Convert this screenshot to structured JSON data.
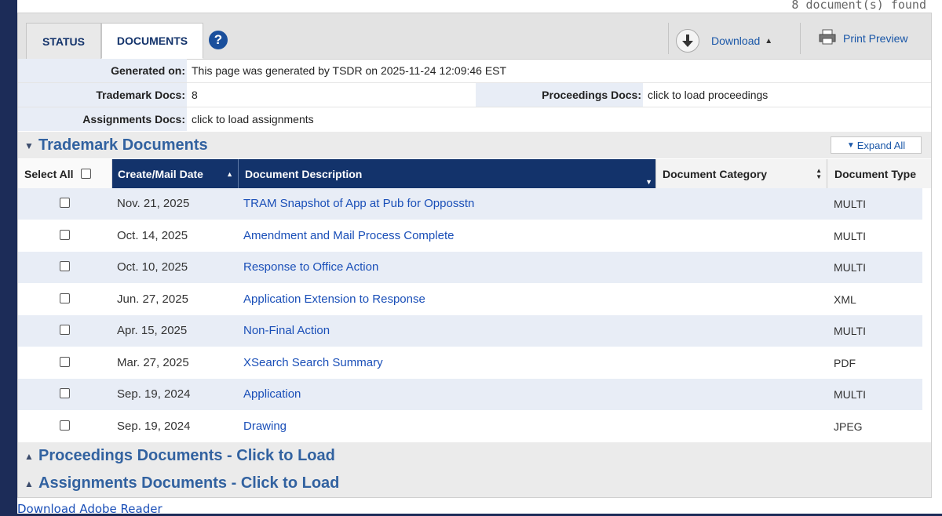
{
  "found_text": "8 document(s) found",
  "tabs": {
    "status": "STATUS",
    "documents": "DOCUMENTS",
    "help": "?"
  },
  "toolbar": {
    "download": "Download",
    "print_preview": "Print Preview"
  },
  "info": {
    "generated_label": "Generated on:",
    "generated_value": "This page was generated by TSDR on 2025-11-24 12:09:46 EST",
    "trademark_label": "Trademark Docs:",
    "trademark_value": "8",
    "proceedings_label": "Proceedings Docs:",
    "proceedings_value": "click to load proceedings",
    "assignments_label": "Assignments Docs:",
    "assignments_value": "click to load assignments"
  },
  "sections": {
    "trademark": "Trademark Documents",
    "expand_all": "Expand All",
    "proceedings": "Proceedings Documents - Click to Load",
    "assignments": "Assignments Documents - Click to Load"
  },
  "table": {
    "headers": {
      "select_all": "Select All",
      "date": "Create/Mail Date",
      "description": "Document Description",
      "category": "Document Category",
      "type": "Document Type"
    },
    "rows": [
      {
        "date": "Nov. 21, 2025",
        "description": "TRAM Snapshot of App at Pub for Opposstn",
        "category": "",
        "type": "MULTI"
      },
      {
        "date": "Oct. 14, 2025",
        "description": "Amendment and Mail Process Complete",
        "category": "",
        "type": "MULTI"
      },
      {
        "date": "Oct. 10, 2025",
        "description": "Response to Office Action",
        "category": "",
        "type": "MULTI"
      },
      {
        "date": "Jun. 27, 2025",
        "description": "Application Extension to Response",
        "category": "",
        "type": "XML"
      },
      {
        "date": "Apr. 15, 2025",
        "description": "Non-Final Action",
        "category": "",
        "type": "MULTI"
      },
      {
        "date": "Mar. 27, 2025",
        "description": "XSearch Search Summary",
        "category": "",
        "type": "PDF"
      },
      {
        "date": "Sep. 19, 2024",
        "description": "Application",
        "category": "",
        "type": "MULTI"
      },
      {
        "date": "Sep. 19, 2024",
        "description": "Drawing",
        "category": "",
        "type": "JPEG"
      }
    ]
  },
  "footer": {
    "adobe": "Download Adobe Reader"
  },
  "colors": {
    "header_navy": "#13336b",
    "link_blue": "#1a4fb8",
    "alt_row": "#e8edf6",
    "section_title": "#3262a0"
  }
}
